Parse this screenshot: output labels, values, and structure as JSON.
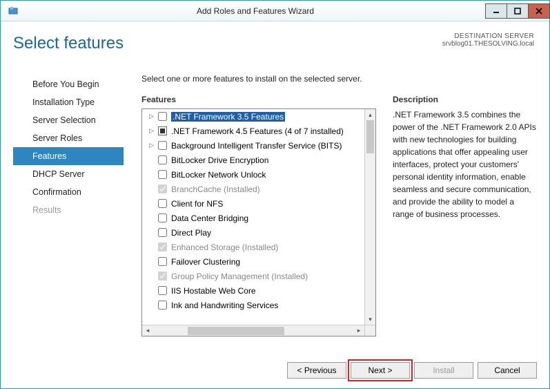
{
  "window_title": "Add Roles and Features Wizard",
  "page_title": "Select features",
  "destination": {
    "heading": "DESTINATION SERVER",
    "server": "srvblog01.THESOLVING.local"
  },
  "nav": {
    "items": [
      {
        "label": "Before You Begin",
        "state": ""
      },
      {
        "label": "Installation Type",
        "state": ""
      },
      {
        "label": "Server Selection",
        "state": ""
      },
      {
        "label": "Server Roles",
        "state": ""
      },
      {
        "label": "Features",
        "state": "active"
      },
      {
        "label": "DHCP Server",
        "state": ""
      },
      {
        "label": "Confirmation",
        "state": ""
      },
      {
        "label": "Results",
        "state": "disabled"
      }
    ]
  },
  "instruction": "Select one or more features to install on the selected server.",
  "features_label": "Features",
  "description_label": "Description",
  "description_text": ".NET Framework 3.5 combines the power of the .NET Framework 2.0 APIs with new technologies for building applications that offer appealing user interfaces, protect your customers' personal identity information, enable seamless and secure communication, and provide the ability to model a range of business processes.",
  "features": [
    {
      "label": ".NET Framework 3.5 Features",
      "expandable": true,
      "check": "empty",
      "selected": true
    },
    {
      "label": ".NET Framework 4.5 Features (4 of 7 installed)",
      "expandable": true,
      "check": "tri"
    },
    {
      "label": "Background Intelligent Transfer Service (BITS)",
      "expandable": true,
      "check": "empty"
    },
    {
      "label": "BitLocker Drive Encryption",
      "expandable": false,
      "check": "empty"
    },
    {
      "label": "BitLocker Network Unlock",
      "expandable": false,
      "check": "empty"
    },
    {
      "label": "BranchCache (Installed)",
      "expandable": false,
      "check": "checked",
      "grey": true
    },
    {
      "label": "Client for NFS",
      "expandable": false,
      "check": "empty"
    },
    {
      "label": "Data Center Bridging",
      "expandable": false,
      "check": "empty"
    },
    {
      "label": "Direct Play",
      "expandable": false,
      "check": "empty"
    },
    {
      "label": "Enhanced Storage (Installed)",
      "expandable": false,
      "check": "checked",
      "grey": true
    },
    {
      "label": "Failover Clustering",
      "expandable": false,
      "check": "empty"
    },
    {
      "label": "Group Policy Management (Installed)",
      "expandable": false,
      "check": "checked",
      "grey": true
    },
    {
      "label": "IIS Hostable Web Core",
      "expandable": false,
      "check": "empty"
    },
    {
      "label": "Ink and Handwriting Services",
      "expandable": false,
      "check": "empty"
    }
  ],
  "buttons": {
    "previous": "< Previous",
    "next": "Next >",
    "install": "Install",
    "cancel": "Cancel"
  }
}
